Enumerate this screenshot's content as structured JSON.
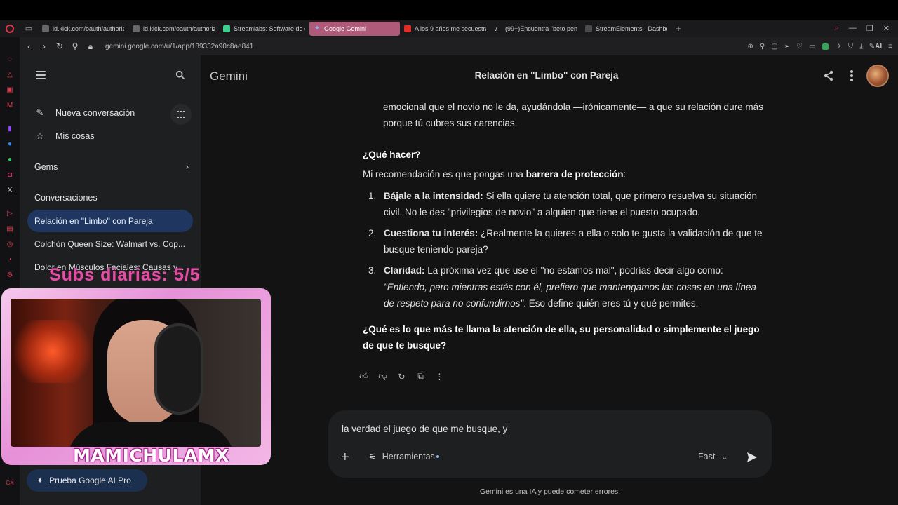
{
  "browser": {
    "tabs": [
      {
        "label": "id.kick.com/oauth/authoriz",
        "favicon": "page-icon",
        "active": false
      },
      {
        "label": "id.kick.com/oauth/authoriz",
        "favicon": "page-icon",
        "active": false
      },
      {
        "label": "Streamlabs: Software de c",
        "favicon": "streamlabs-icon",
        "active": false
      },
      {
        "label": "Google Gemini",
        "favicon": "gemini-icon",
        "active": true
      },
      {
        "label": "A los 9 años me secuestra",
        "favicon": "youtube-icon",
        "active": false
      },
      {
        "label": "(99+)Encuentra \"beto pen",
        "favicon": "tiktok-icon",
        "active": false
      },
      {
        "label": "StreamElements - Dashboa",
        "favicon": "streamelements-icon",
        "active": false
      }
    ],
    "url": "gemini.google.com/u/1/app/189332a90c8ae841",
    "ai_label": "AI",
    "accent_color": "#e0384a"
  },
  "sidebar": {
    "new_chat": "Nueva conversación",
    "my_stuff": "Mis cosas",
    "gems": "Gems",
    "conversations_title": "Conversaciones",
    "conversations": [
      {
        "label": "Relación en \"Limbo\" con Pareja",
        "active": true
      },
      {
        "label": "Colchón Queen Size: Walmart vs. Cop...",
        "active": false
      },
      {
        "label": "Dolor en Músculos Faciales: Causas y...",
        "active": false
      }
    ],
    "pro_button": "Prueba Google AI Pro"
  },
  "header": {
    "brand": "Gemini",
    "title": "Relación en \"Limbo\" con Pareja"
  },
  "response": {
    "intro_line1": "emocional que el novio no le da, ayudándola —irónicamente— a que su relación dure más",
    "intro_line2": "porque tú cubres sus carencias.",
    "what_to_do": "¿Qué hacer?",
    "recommendation_pre": "Mi recomendación es que pongas una ",
    "recommendation_bold": "barrera de protección",
    "recommendation_post": ":",
    "items": [
      {
        "num": "1.",
        "title": "Bájale a la intensidad:",
        "line1": " Si ella quiere tu atención total, que primero resuelva su situación",
        "line2": "civil. No le des \"privilegios de novio\" a alguien que tiene el puesto ocupado."
      },
      {
        "num": "2.",
        "title": "Cuestiona tu interés:",
        "line1": " ¿Realmente la quieres a ella o solo te gusta la validación de que te",
        "line2": "busque teniendo pareja?"
      },
      {
        "num": "3.",
        "title": "Claridad:",
        "line1": " La próxima vez que use el \"no estamos mal\", podrías decir algo como:",
        "line2": "\"Entiendo, pero mientras estés con él, prefiero que mantengamos las cosas en una línea",
        "line3_italic": "de respeto para no confundirnos\"",
        "line3_rest": ". Eso define quién eres tú y qué permites."
      }
    ],
    "question_line1": "¿Qué es lo que más te llama la atención de ella, su personalidad o simplemente el juego",
    "question_line2": "de que te busque?"
  },
  "composer": {
    "input_value": "la verdad el juego de que me busque, y",
    "tools_label": "Herramientas",
    "mode_label": "Fast",
    "disclaimer": "Gemini es una IA y puede cometer errores."
  },
  "overlay": {
    "subs_text": "Subs diarias: 5/5",
    "streamer_name": "MAMICHULAMX",
    "frame_color": "#e690d8",
    "subs_color": "#e14fa3"
  }
}
